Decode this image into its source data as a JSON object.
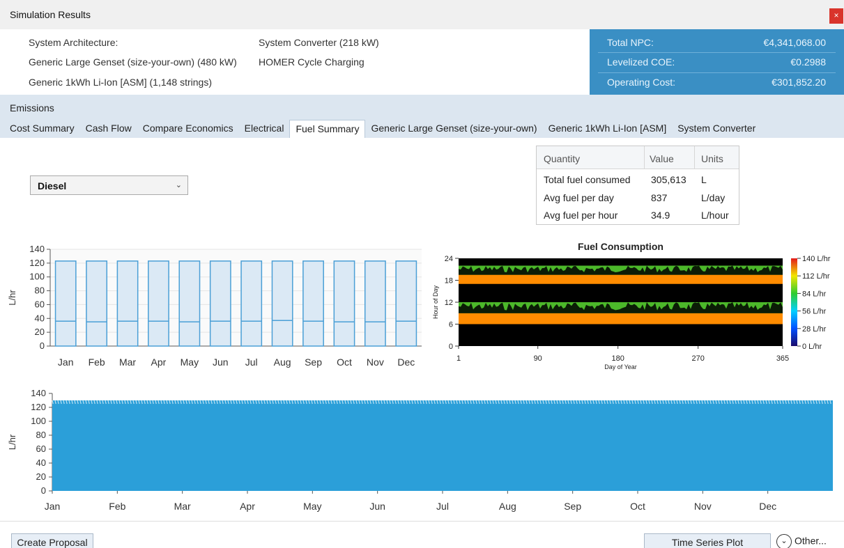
{
  "window": {
    "title": "Simulation Results",
    "close_label": "×"
  },
  "architecture": {
    "heading": "System Architecture:",
    "items": [
      "Generic Large Genset (size-your-own) (480 kW)",
      "Generic 1kWh Li-Ion [ASM] (1,148 strings)",
      "System Converter (218 kW)",
      "HOMER Cycle Charging"
    ]
  },
  "metrics": [
    {
      "label": "Total NPC:",
      "value": "€4,341,068.00"
    },
    {
      "label": "Levelized COE:",
      "value": "€0.2988"
    },
    {
      "label": "Operating Cost:",
      "value": "€301,852.20"
    }
  ],
  "tabs": {
    "emissions": "Emissions",
    "items": [
      "Cost Summary",
      "Cash Flow",
      "Compare Economics",
      "Electrical",
      "Fuel Summary",
      "Generic Large Genset (size-your-own)",
      "Generic 1kWh Li-Ion [ASM]",
      "System Converter"
    ],
    "active": "Fuel Summary"
  },
  "fuel_select": {
    "value": "Diesel"
  },
  "quantity_table": {
    "headers": [
      "Quantity",
      "Value",
      "Units"
    ],
    "rows": [
      [
        "Total fuel consumed",
        "305,613",
        "L"
      ],
      [
        "Avg fuel per day",
        "837",
        "L/day"
      ],
      [
        "Avg fuel per hour",
        "34.9",
        "L/hour"
      ]
    ]
  },
  "chart_data": [
    {
      "type": "bar",
      "title": "",
      "ylabel": "L/hr",
      "ylim": [
        0,
        140
      ],
      "yticks": [
        0,
        20,
        40,
        60,
        80,
        100,
        120,
        140
      ],
      "categories": [
        "Jan",
        "Feb",
        "Mar",
        "Apr",
        "May",
        "Jun",
        "Jul",
        "Aug",
        "Sep",
        "Oct",
        "Nov",
        "Dec"
      ],
      "series": [
        {
          "values_max": [
            123,
            123,
            123,
            123,
            123,
            123,
            123,
            123,
            123,
            123,
            123,
            123
          ]
        },
        {
          "values_mean": [
            36,
            35,
            36,
            36,
            35,
            36,
            36,
            37,
            36,
            35,
            35,
            36
          ]
        }
      ],
      "colors": {
        "box_fill": "#dbe9f5",
        "box_stroke": "#4a9fd6",
        "grid": "#e4e4e4"
      }
    },
    {
      "type": "heatmap",
      "title": "Fuel Consumption",
      "xlabel": "Day of Year",
      "ylabel": "Hour of Day",
      "x_range": [
        1,
        365
      ],
      "x_ticks": [
        1,
        90,
        180,
        270,
        365
      ],
      "y_range": [
        0,
        24
      ],
      "y_ticks": [
        0,
        6,
        12,
        18,
        24
      ],
      "colorbar_ticks": [
        "140 L/hr",
        "112 L/hr",
        "84 L/hr",
        "56 L/hr",
        "28 L/hr",
        "0 L/hr"
      ],
      "colorbar_range": [
        0,
        140
      ],
      "bands": [
        {
          "hour_start": 0,
          "hour_end": 6,
          "level": 0
        },
        {
          "hour_start": 6,
          "hour_end": 9,
          "level": 123
        },
        {
          "hour_start": 9,
          "hour_end": 12,
          "level": 60
        },
        {
          "hour_start": 12,
          "hour_end": 17,
          "level": 0
        },
        {
          "hour_start": 17,
          "hour_end": 19.5,
          "level": 123
        },
        {
          "hour_start": 19.5,
          "hour_end": 22,
          "level": 60
        },
        {
          "hour_start": 22,
          "hour_end": 24,
          "level": 0
        }
      ]
    },
    {
      "type": "area",
      "title": "",
      "ylabel": "L/hr",
      "ylim": [
        0,
        140
      ],
      "yticks": [
        0,
        20,
        40,
        60,
        80,
        100,
        120,
        140
      ],
      "x_ticks": [
        "Jan",
        "Feb",
        "Mar",
        "Apr",
        "May",
        "Jun",
        "Jul",
        "Aug",
        "Sep",
        "Oct",
        "Nov",
        "Dec"
      ],
      "peak_value": 130,
      "color": "#2b9fd9"
    }
  ],
  "buttons": {
    "create_proposal": "Create Proposal",
    "time_series_plot": "Time Series Plot",
    "other": "Other..."
  }
}
